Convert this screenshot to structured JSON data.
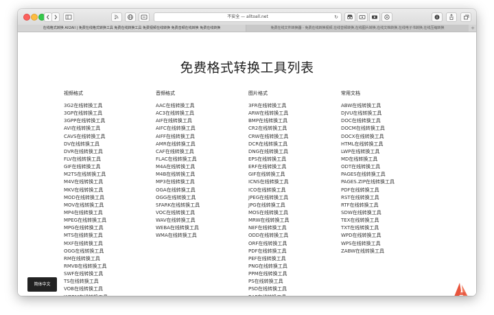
{
  "browser": {
    "url": "不安全 — alltoall.net",
    "tabs": [
      {
        "label": "在线格式转换 All2All | 免费在线格式转换工具 免费在线转换工具 免费视频在线转换 免费音频在线转换 免费在线转换"
      },
      {
        "label": "免费在线文件转换器 - 免费在线转换视频,在线音频转换,在线图片转换,在线文档转换,在线电子书转换,在线压缩转换"
      }
    ],
    "reload_glyph": "↻",
    "add_tab_glyph": "+"
  },
  "page": {
    "title": "免费格式转换工具列表",
    "language_button": "简体中文"
  },
  "columns": [
    {
      "heading": "视频格式",
      "items": [
        "3G2在线转换工具",
        "3GP在线转换工具",
        "3GPP在线转换工具",
        "AVI在线转换工具",
        "CAVS在线转换工具",
        "DV在线转换工具",
        "DVR在线转换工具",
        "FLV在线转换工具",
        "GIF在线转换工具",
        "M2TS在线转换工具",
        "M4V在线转换工具",
        "MKV在线转换工具",
        "MOD在线转换工具",
        "MOV在线转换工具",
        "MP4在线转换工具",
        "MPEG在线转换工具",
        "MPG在线转换工具",
        "MTS在线转换工具",
        "MXF在线转换工具",
        "OGG在线转换工具",
        "RM在线转换工具",
        "RMVB在线转换工具",
        "SWF在线转换工具",
        "TS在线转换工具",
        "VOB在线转换工具",
        "WEBM在线转换工具"
      ]
    },
    {
      "heading": "音频格式",
      "items": [
        "AAC在线转换工具",
        "AC3在线转换工具",
        "AIF在线转换工具",
        "AIFC在线转换工具",
        "AIFF在线转换工具",
        "AMR在线转换工具",
        "CAF在线转换工具",
        "FLAC在线转换工具",
        "M4A在线转换工具",
        "M4B在线转换工具",
        "MP3在线转换工具",
        "OGA在线转换工具",
        "OGG在线转换工具",
        "SFARK在线转换工具",
        "VOC在线转换工具",
        "WAV在线转换工具",
        "WEBA在线转换工具",
        "WMA在线转换工具"
      ]
    },
    {
      "heading": "图片格式",
      "items": [
        "3FR在线转换工具",
        "ARW在线转换工具",
        "BMP在线转换工具",
        "CR2在线转换工具",
        "CRW在线转换工具",
        "DCR在线转换工具",
        "DNG在线转换工具",
        "EPS在线转换工具",
        "ERF在线转换工具",
        "GIF在线转换工具",
        "ICNS在线转换工具",
        "ICO在线转换工具",
        "JPEG在线转换工具",
        "JPG在线转换工具",
        "MOS在线转换工具",
        "MRW在线转换工具",
        "NEF在线转换工具",
        "ODD在线转换工具",
        "ORF在线转换工具",
        "PDF在线转换工具",
        "PEF在线转换工具",
        "PNG在线转换工具",
        "PPM在线转换工具",
        "PS在线转换工具",
        "PSD在线转换工具",
        "RAF在线转换工具"
      ]
    },
    {
      "heading": "常用文档",
      "items": [
        "ABW在线转换工具",
        "DJVU在线转换工具",
        "DOC在线转换工具",
        "DOCM在线转换工具",
        "DOCX在线转换工具",
        "HTML在线转换工具",
        "LWP在线转换工具",
        "MD在线转换工具",
        "ODT在线转换工具",
        "PAGES在线转换工具",
        "PAGES.ZIP在线转换工具",
        "PDF在线转换工具",
        "RST在线转换工具",
        "RTF在线转换工具",
        "SDW在线转换工具",
        "TEX在线转换工具",
        "TXT在线转换工具",
        "WPD在线转换工具",
        "WPS在线转换工具",
        "ZABW在线转换工具"
      ]
    }
  ],
  "colors": {
    "logo": "#e8553d",
    "lang_button_bg": "#222222"
  }
}
